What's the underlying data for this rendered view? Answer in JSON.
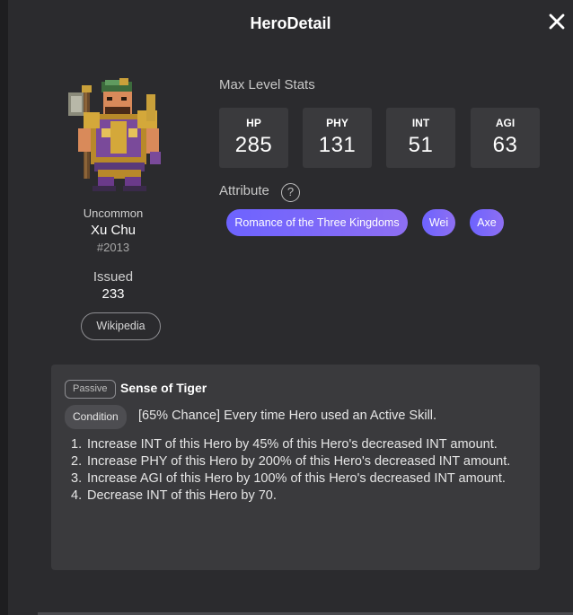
{
  "modal": {
    "title": "HeroDetail"
  },
  "hero": {
    "rarity": "Uncommon",
    "name": "Xu Chu",
    "id": "#2013",
    "issued_label": "Issued",
    "issued_value": "233",
    "wiki_label": "Wikipedia"
  },
  "stats": {
    "label": "Max Level Stats",
    "items": [
      {
        "key": "HP",
        "value": "285"
      },
      {
        "key": "PHY",
        "value": "131"
      },
      {
        "key": "INT",
        "value": "51"
      },
      {
        "key": "AGI",
        "value": "63"
      }
    ]
  },
  "attributes": {
    "label": "Attribute",
    "help_glyph": "?",
    "tags": [
      "Romance of the Three Kingdoms",
      "Wei",
      "Axe"
    ]
  },
  "skill": {
    "type_badge": "Passive",
    "name": "Sense of Tiger",
    "condition_badge": "Condition",
    "condition_text": "[65% Chance] Every time Hero used an Active Skill.",
    "effects": [
      {
        "num": "1.",
        "text": "Increase INT of this Hero by 45% of this Hero's decreased INT amount."
      },
      {
        "num": "2.",
        "text": "Increase PHY of this Hero by 200% of this Hero's decreased INT amount."
      },
      {
        "num": "3.",
        "text": "Increase AGI of this Hero by 100% of this Hero's decreased INT amount."
      },
      {
        "num": "4.",
        "text": "Decrease INT of this Hero by 70."
      }
    ]
  },
  "colors": {
    "modal_bg": "#2b2b2e",
    "card_bg": "#3a3a3d",
    "tag_gradient_start": "#6d63ff",
    "tag_gradient_end": "#8e6ff2"
  },
  "icons": {
    "close": "close-icon",
    "help": "help-circle-icon"
  }
}
